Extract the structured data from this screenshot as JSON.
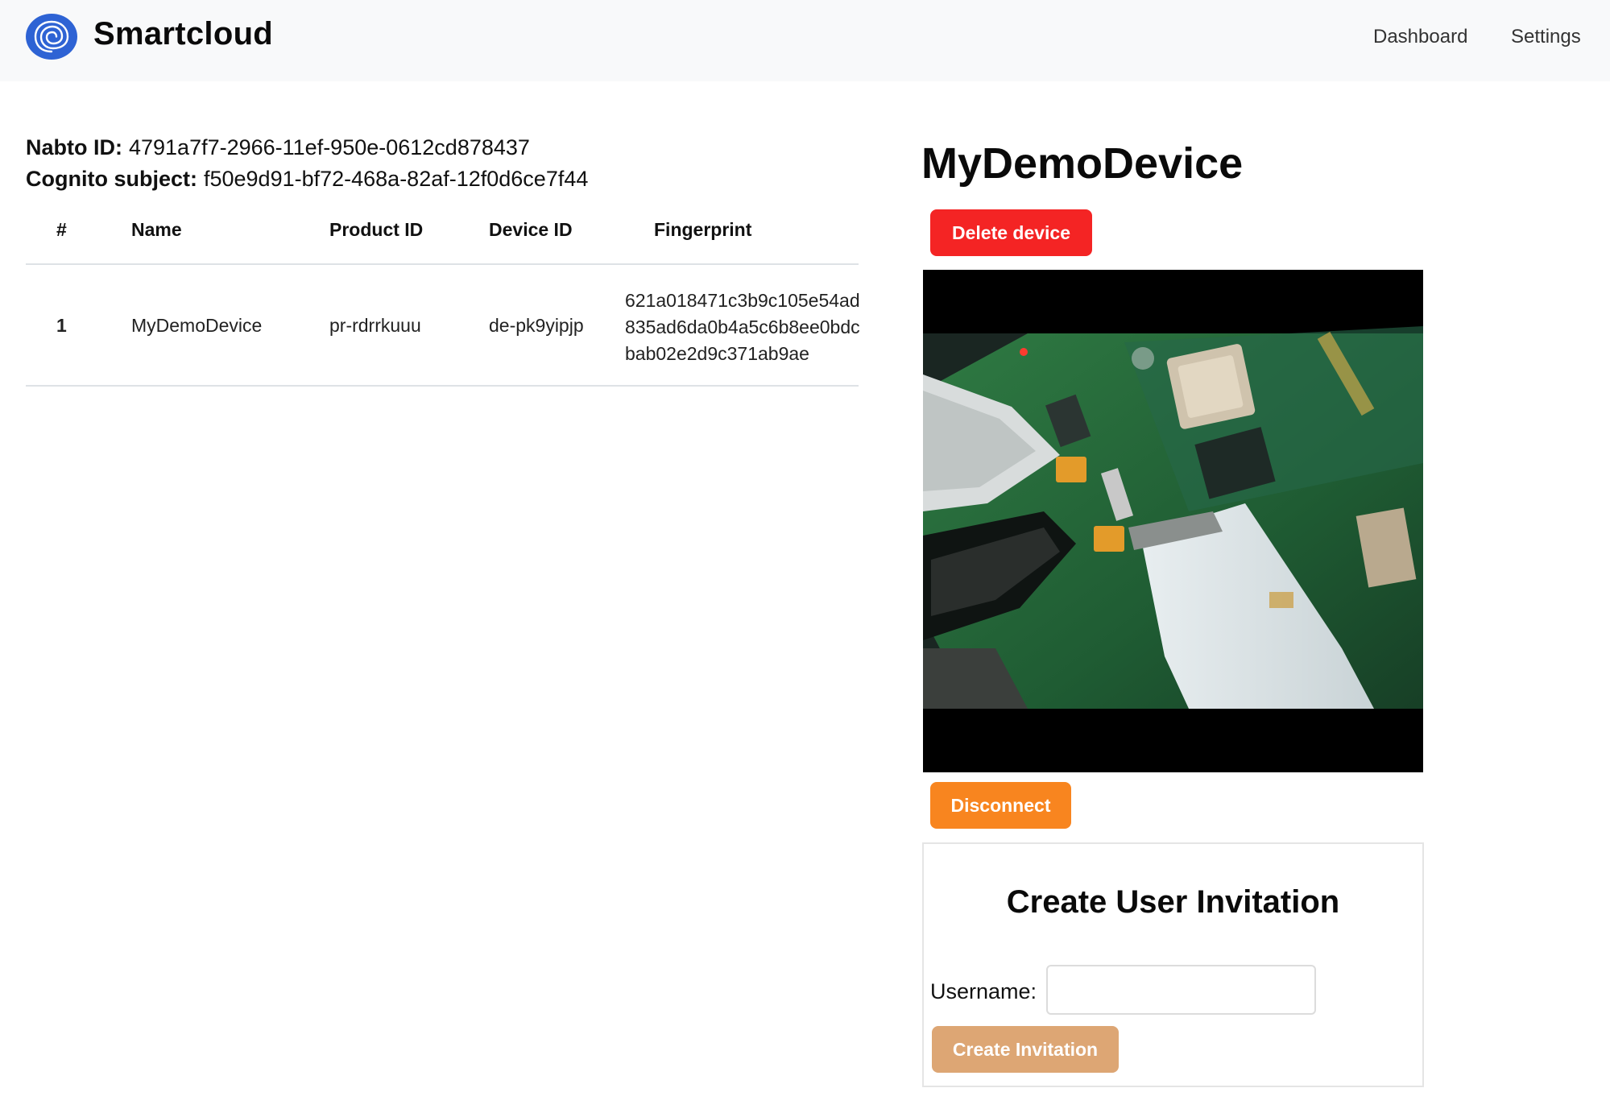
{
  "app": {
    "name": "Smartcloud",
    "logo_icon": "spiral-logo-icon",
    "accent_color": "#2e63d4"
  },
  "nav": {
    "items": [
      {
        "label": "Dashboard"
      },
      {
        "label": "Settings"
      }
    ]
  },
  "user_info": {
    "nabto_label": "Nabto ID:",
    "nabto_id": "4791a7f7-2966-11ef-950e-0612cd878437",
    "cognito_label": "Cognito subject:",
    "cognito_subject": "f50e9d91-bf72-468a-82af-12f0d6ce7f44"
  },
  "devices_table": {
    "columns": [
      "#",
      "Name",
      "Product ID",
      "Device ID",
      "Fingerprint"
    ],
    "rows": [
      {
        "num": "1",
        "name": "MyDemoDevice",
        "product_id": "pr-rdrrkuuu",
        "device_id": "de-pk9yipjp",
        "fingerprint": "621a018471c3b9c105e54ad835ad6da0b4a5c6b8ee0bdcbab02e2d9c371ab9ae"
      }
    ]
  },
  "device_panel": {
    "title": "MyDemoDevice",
    "delete_label": "Delete device",
    "disconnect_label": "Disconnect",
    "delete_color": "#f42424",
    "disconnect_color": "#f8851f"
  },
  "invitation": {
    "title": "Create User Invitation",
    "username_label": "Username:",
    "username_value": "",
    "submit_label": "Create Invitation",
    "submit_color": "#dda674"
  }
}
